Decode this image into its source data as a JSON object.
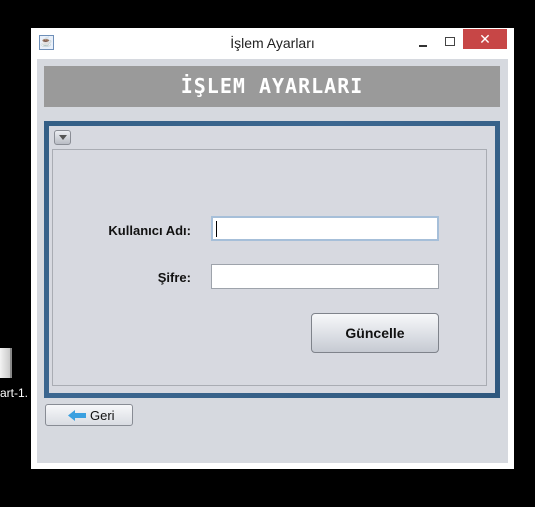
{
  "desktop": {
    "icon_label": "art-1."
  },
  "window": {
    "title": "İşlem Ayarları",
    "close_glyph": "✕",
    "app_icon_glyph": "☕"
  },
  "header": {
    "title": "İŞLEM AYARLARI"
  },
  "form": {
    "username_label": "Kullanıcı Adı:",
    "username_value": "",
    "password_label": "Şifre:",
    "password_value": "",
    "update_button": "Güncelle"
  },
  "footer": {
    "back_button": "Geri"
  },
  "colors": {
    "frame": "#345f86",
    "header_bg": "#9a9a9a",
    "close_bg": "#c74646",
    "back_arrow": "#3aa0e0"
  },
  "icons": {
    "app": "java-cup-icon",
    "collapse": "chevron-down-icon",
    "back": "arrow-left-icon"
  }
}
